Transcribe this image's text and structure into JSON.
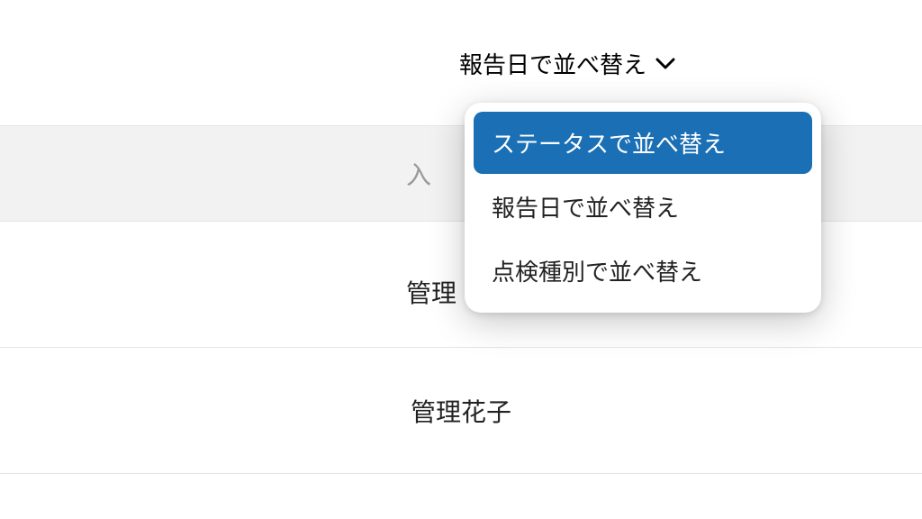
{
  "sort": {
    "trigger_label": "報告日で並べ替え",
    "options": [
      "ステータスで並べ替え",
      "報告日で並べ替え",
      "点検種別で並べ替え"
    ]
  },
  "shaded": {
    "partial_text": "入"
  },
  "rows": [
    {
      "label_partial": "管理"
    },
    {
      "label": "管理花子"
    }
  ]
}
